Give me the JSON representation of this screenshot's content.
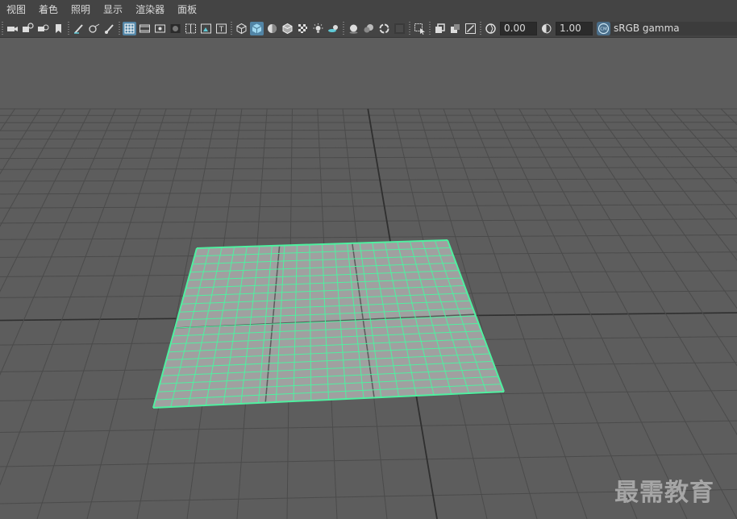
{
  "menu": [
    "视图",
    "着色",
    "照明",
    "显示",
    "渲染器",
    "面板"
  ],
  "toolbar": {
    "exposure_value": "0.00",
    "gamma_value": "1.00",
    "color_management_badge": "CM",
    "color_space_label": "sRGB gamma",
    "icons": [
      "camera-select-icon",
      "camera-attributes-icon",
      "camera-bookmark-icon",
      "bookmark-icon",
      "grease-pencil-icon",
      "camera-target-icon",
      "paint-brush-icon",
      "grid-toggle-icon",
      "film-gate-icon",
      "resolution-gate-icon",
      "gate-mask-icon",
      "field-chart-icon",
      "safe-action-icon",
      "safe-title-icon",
      "wireframe-icon",
      "smooth-shade-icon",
      "default-material-icon",
      "wireframe-on-shaded-icon",
      "textured-icon",
      "lights-icon",
      "shadows-icon",
      "screen-space-ao-icon",
      "motion-blur-icon",
      "anti-aliasing-icon",
      "depth-of-field-icon",
      "isolate-select-icon",
      "xray-icon",
      "xray-joints-icon",
      "xray-active-icon",
      "exposure-icon",
      "gamma-icon",
      "color-management-icon"
    ]
  },
  "colors": {
    "viewport_bg": "#5d5d5d",
    "grid_line": "#4b4b4b",
    "grid_axis": "#2f2f2f",
    "selection_highlight": "#4ff0a0",
    "plane_fill": "#a0a0a0",
    "toolbar_bg": "#444444",
    "active_button": "#5285a6"
  },
  "viewport": {
    "object": "plane",
    "selected": true
  },
  "watermark": "最需教育"
}
